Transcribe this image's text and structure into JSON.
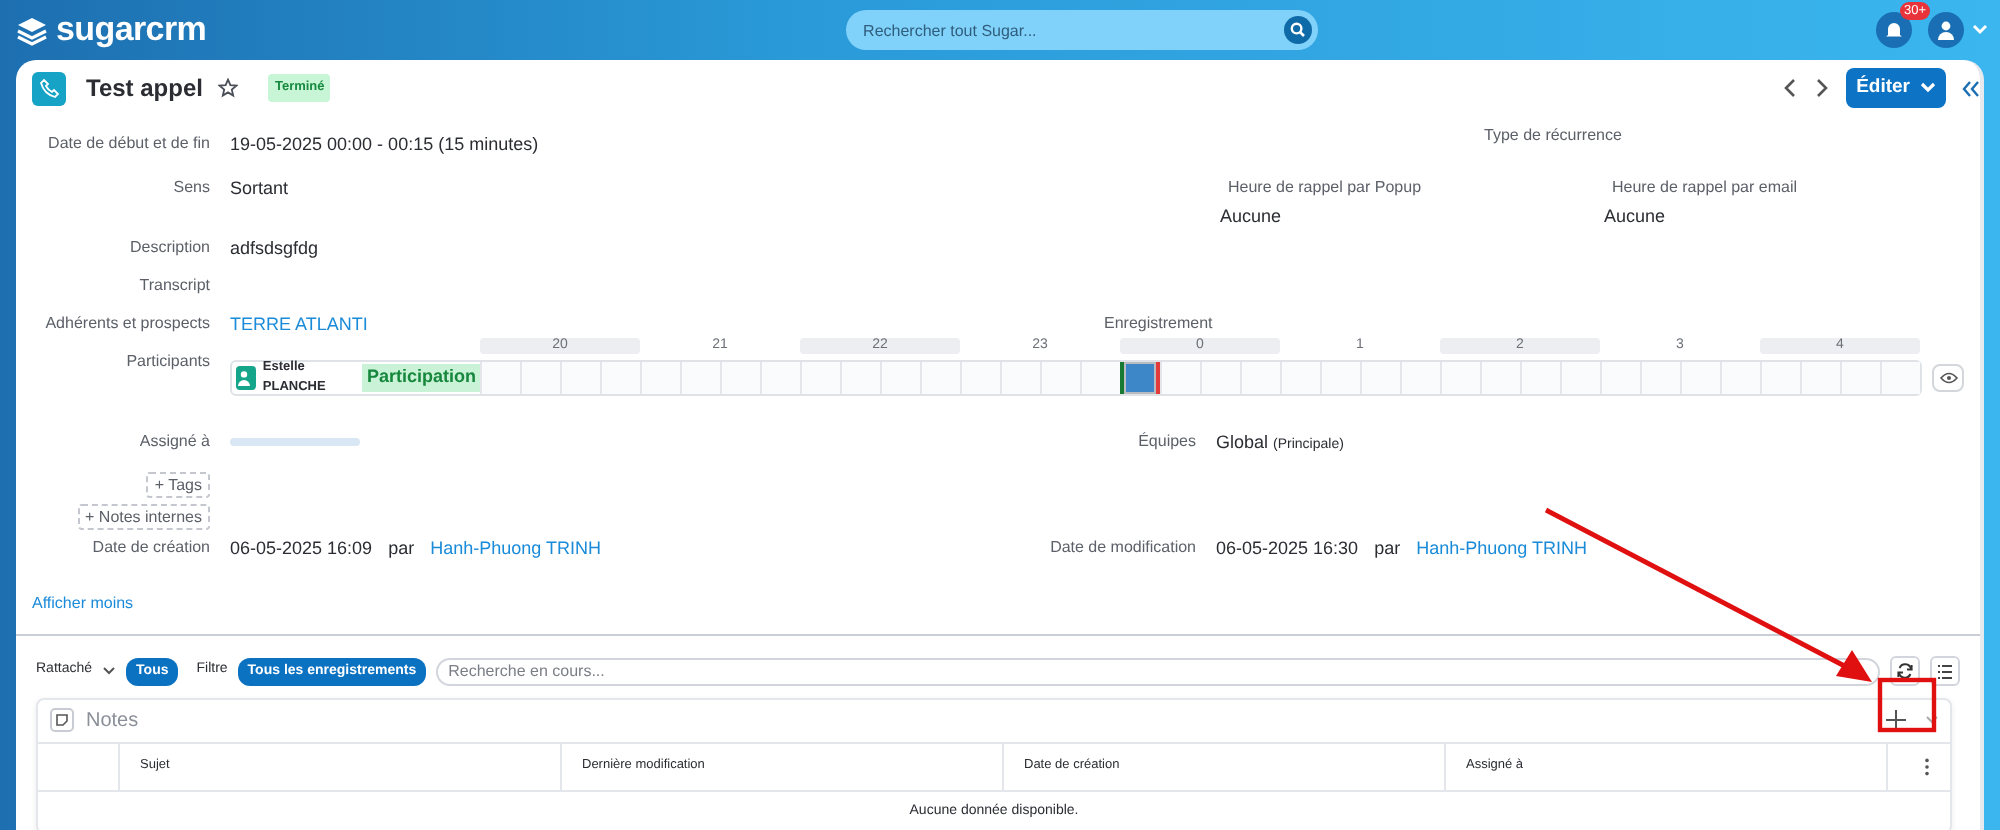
{
  "topbar": {
    "logo": "sugarcrm",
    "search_placeholder": "Rechercher tout Sugar...",
    "notification_count": "30+"
  },
  "record": {
    "title": "Test appel",
    "favorite": false,
    "status": "Terminé",
    "edit_button": "Éditer"
  },
  "rows": [
    {
      "left": {
        "kind": "text",
        "label": "Date de début et de fin",
        "value": "19-05-2025 00:00 - 00:15 (15 minutes)"
      },
      "right": [
        {
          "kind": "stacked",
          "label": "Type de récurrence"
        }
      ]
    },
    {
      "left": {
        "kind": "text",
        "label": "Sens",
        "value": "Sortant"
      },
      "right": [
        {
          "kind": "stacked",
          "label": "Heure de rappel par Popup",
          "value": "Aucune"
        },
        {
          "kind": "stacked",
          "label": "Heure de rappel par email",
          "value": "Aucune"
        }
      ]
    },
    {
      "left": {
        "kind": "text",
        "label": "Description",
        "value": "adfsdsgfdg"
      },
      "right": []
    },
    {
      "left": {
        "kind": "text",
        "label": "Transcript"
      },
      "right": []
    },
    {
      "left": {
        "kind": "link",
        "label": "Adhérents et prospects",
        "value": "TERRE ATLANTI"
      },
      "right": [
        {
          "kind": "stacked",
          "label": "Enregistrement"
        }
      ]
    },
    {
      "left": {
        "kind": "participants",
        "label": "Participants"
      },
      "right": []
    },
    {
      "left": {
        "kind": "redacted",
        "label": "Assigné à"
      },
      "right": [
        {
          "kind": "inline",
          "label": "Équipes",
          "value": "Global",
          "note": "(Principale)"
        }
      ]
    },
    {
      "left": {
        "kind": "button",
        "value": "+ Tags"
      },
      "right": []
    },
    {
      "left": {
        "kind": "button",
        "value": "+ Notes internes"
      },
      "right": []
    },
    {
      "left": {
        "kind": "audit",
        "label": "Date de création",
        "value": "06-05-2025 16:09",
        "by": "par",
        "user": "Hanh-Phuong TRINH"
      },
      "right": [
        {
          "kind": "audit",
          "label": "Date de modification",
          "value": "06-05-2025 16:30",
          "by": "par",
          "user": "Hanh-Phuong TRINH"
        }
      ]
    }
  ],
  "participants": {
    "name": "Estelle PLANCHE",
    "status": "Participation",
    "hours": [
      {
        "label": "20",
        "busy": false
      },
      {
        "label": "21",
        "busy": false
      },
      {
        "label": "22",
        "busy": false
      },
      {
        "label": "23",
        "busy": false
      },
      {
        "label": "0",
        "busy": true
      },
      {
        "label": "1",
        "busy": false
      },
      {
        "label": "2",
        "busy": false
      },
      {
        "label": "3",
        "busy": false
      },
      {
        "label": "4",
        "busy": false
      }
    ]
  },
  "show_less": "Afficher moins",
  "toolbar": {
    "related": "Rattaché",
    "related_value": "Tous",
    "filter": "Filtre",
    "filter_value": "Tous les enregistrements",
    "search_placeholder": "Recherche en cours..."
  },
  "notes": {
    "title": "Notes",
    "columns": [
      "Sujet",
      "Dernière modification",
      "Date de création",
      "Assigné à"
    ],
    "empty": "Aucune donnée disponible."
  }
}
